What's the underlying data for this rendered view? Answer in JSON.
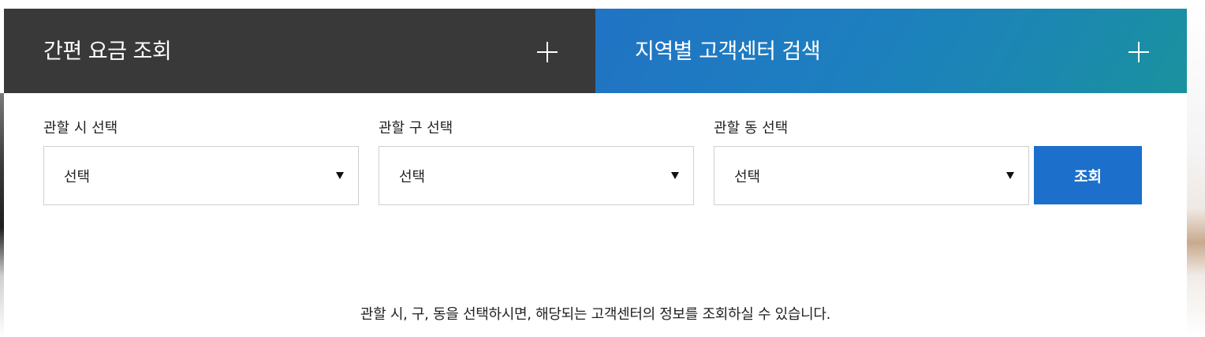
{
  "tabs": {
    "fee": {
      "title": "간편 요금 조회"
    },
    "center": {
      "title": "지역별 고객센터 검색"
    }
  },
  "filters": {
    "city": {
      "label": "관할 시 선택",
      "value": "선택"
    },
    "district": {
      "label": "관할 구 선택",
      "value": "선택"
    },
    "dong": {
      "label": "관할 동 선택",
      "value": "선택"
    }
  },
  "search_button": "조회",
  "guide_text": "관할 시, 구, 동을 선택하시면, 해당되는 고객센터의 정보를 조회하실 수 있습니다.",
  "icons": {
    "tab_fee_expand": "plus-icon",
    "tab_center_expand": "plus-icon",
    "dropdown": "caret-down-icon"
  },
  "colors": {
    "tab_fee_bg": "#393939",
    "tab_center_bg": "#1e7dc0",
    "button_bg": "#1c6fcb"
  }
}
